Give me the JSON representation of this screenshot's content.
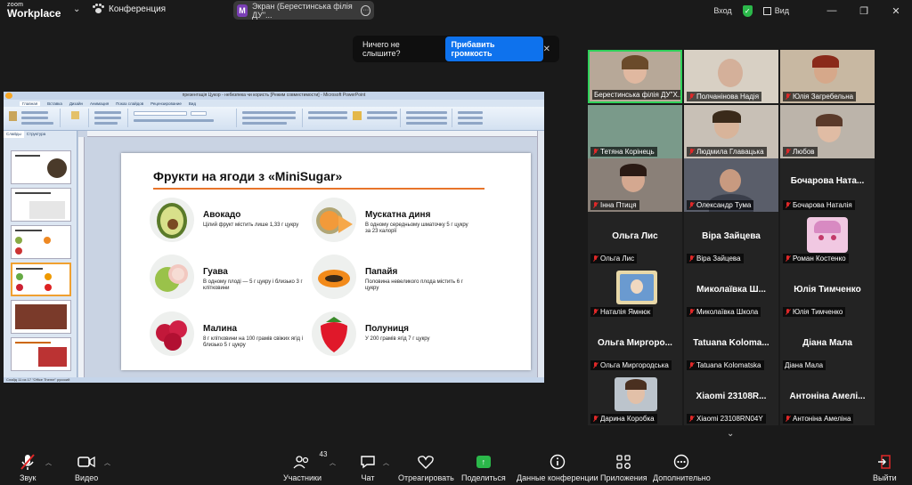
{
  "topbar": {
    "logo_line1": "zoom",
    "logo_line2": "Workplace",
    "conference_label": "Конференция",
    "screen_badge": "M",
    "screen_label": "Экран (Берестинська філія ДУ\"...",
    "login": "Вход",
    "view": "Вид"
  },
  "notice": {
    "text": "Ничего не слышите?",
    "button": "Прибавить громкость"
  },
  "powerpoint": {
    "window_title": "презентація Цукор - небезпека чи користь [Режим совместимости] - Microsoft PowerPoint",
    "tabs": [
      "Главная",
      "Вставка",
      "Дизайн",
      "Анимация",
      "Показ слайдов",
      "Рецензирование",
      "Вид"
    ],
    "thumb_tabs": [
      "Слайды",
      "Структура"
    ],
    "status": "Слайд 11 из 17    \"Office Theme\"    русский"
  },
  "slide": {
    "title": "Фрукти на ягоди з «MiniSugar»",
    "fruits": [
      {
        "name": "Авокадо",
        "desc": "Цілий фрукт містить лише 1,33 г цукру"
      },
      {
        "name": "Гуава",
        "desc": "В одному плоді — 5 г цукру і близько 3 г клітковини"
      },
      {
        "name": "Малина",
        "desc": "8 г клітковини на 100 грамів свіжих ягід і близько 5 г цукру"
      },
      {
        "name": "Мускатна диня",
        "desc": "В одному середньому шматочку 5 г цукру за 23 калорії"
      },
      {
        "name": "Папайя",
        "desc": "Половина невеликого плода містить 6 г цукру"
      },
      {
        "name": "Полуниця",
        "desc": "У 200 грамів ягід 7 г цукру"
      }
    ]
  },
  "participants": [
    {
      "label": "Берестинська філія ДУ\"Х...",
      "big": "",
      "kind": "photo"
    },
    {
      "label": "Полчанінова Надія",
      "big": "",
      "kind": "photo"
    },
    {
      "label": "Юлія Загребельна",
      "big": "",
      "kind": "photo"
    },
    {
      "label": "Тетяна Корінець",
      "big": "",
      "kind": "photo"
    },
    {
      "label": "Людмила Главацька",
      "big": "",
      "kind": "photo"
    },
    {
      "label": "Любов",
      "big": "",
      "kind": "photo"
    },
    {
      "label": "Інна Птиця",
      "big": "",
      "kind": "photo"
    },
    {
      "label": "Олександр Тума",
      "big": "",
      "kind": "photo"
    },
    {
      "label": "Бочарова Наталія",
      "big": "Бочарова Ната...",
      "kind": "name"
    },
    {
      "label": "Ольга Лис",
      "big": "Ольга Лис",
      "kind": "name"
    },
    {
      "label": "Віра Зайцева",
      "big": "Віра Зайцева",
      "kind": "name"
    },
    {
      "label": "Роман Костенко",
      "big": "",
      "kind": "avatar"
    },
    {
      "label": "Наталія Ямнюк",
      "big": "",
      "kind": "avatar"
    },
    {
      "label": "Миколаївка Школа",
      "big": "Миколаївка Ш...",
      "kind": "name"
    },
    {
      "label": "Юлія Тимченко",
      "big": "Юлія Тимченко",
      "kind": "name"
    },
    {
      "label": "Ольга Миргородська",
      "big": "Ольга Миргоро...",
      "kind": "name"
    },
    {
      "label": "Tatuana Kolomatska",
      "big": "Tatuana Koloma...",
      "kind": "name"
    },
    {
      "label": "Діана Мала",
      "big": "Діана Мала",
      "kind": "name"
    },
    {
      "label": "Дарина Коробка",
      "big": "",
      "kind": "avatar"
    },
    {
      "label": "Xiaomi 23108RN04Y",
      "big": "Xiaomi 23108R...",
      "kind": "name"
    },
    {
      "label": "Антоніна Амеліна",
      "big": "Антоніна Амелі...",
      "kind": "name"
    }
  ],
  "toolbar": {
    "audio": "Звук",
    "video": "Видео",
    "participants": "Участники",
    "participants_count": "43",
    "chat": "Чат",
    "react": "Отреагировать",
    "share": "Поделиться",
    "info": "Данные конференции",
    "apps": "Приложения",
    "more": "Дополнительно",
    "leave": "Выйти"
  },
  "colors": {
    "accent_blue": "#0e72ed",
    "active_speaker": "#2fd15a",
    "mute_red": "#e02828",
    "share_green": "#2bb84a",
    "slide_rule": "#e8742a"
  }
}
